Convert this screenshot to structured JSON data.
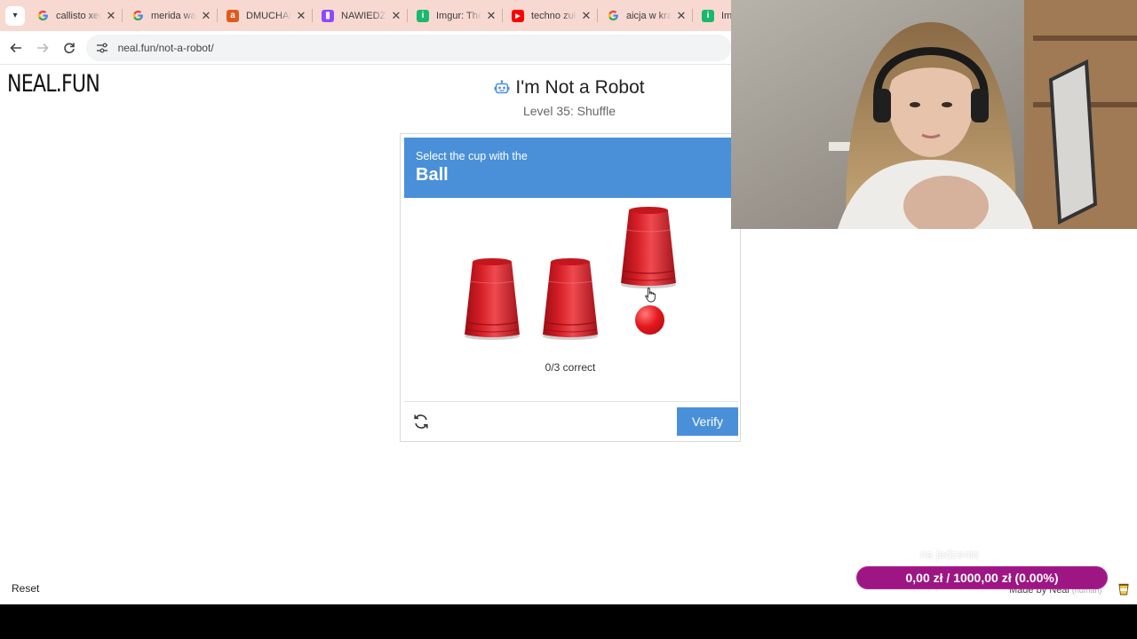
{
  "browser": {
    "tabs": [
      {
        "title": "callisto xeno",
        "favicon": "google-icon"
      },
      {
        "title": "merida wal",
        "favicon": "google-icon"
      },
      {
        "title": "DMUCHAN",
        "favicon": "a-logo-icon"
      },
      {
        "title": "NAWIEDZ",
        "favicon": "twitch-icon"
      },
      {
        "title": "Imgur: The",
        "favicon": "imgur-icon"
      },
      {
        "title": "techno zuł",
        "favicon": "youtube-icon"
      },
      {
        "title": "aicja w kra",
        "favicon": "google-icon"
      },
      {
        "title": "Img",
        "favicon": "imgur-icon"
      }
    ],
    "url": "neal.fun/not-a-robot/"
  },
  "page": {
    "logo": "NEAL.FUN",
    "title": "I'm Not a Robot",
    "subtitle": "Level 35: Shuffle",
    "reset_label": "Reset",
    "made_by": "Made by Neal",
    "made_by_note": "(human)"
  },
  "captcha": {
    "prompt": "Select the cup with the",
    "target": "Ball",
    "score_text": "0/3 correct",
    "verify_label": "Verify",
    "cup_count": 3,
    "lifted_cup": 3
  },
  "stream": {
    "donation_caption": "na jedzenie",
    "donation_text": "0,00 zł  /  1000,00 zł (0.00%)",
    "donation_progress": 0.0
  },
  "colors": {
    "accent_blue": "#4a90d9",
    "cup_red": "#d61f27",
    "tabbar_bg": "#f7d9d1",
    "donation_purple": "#9e1684"
  }
}
